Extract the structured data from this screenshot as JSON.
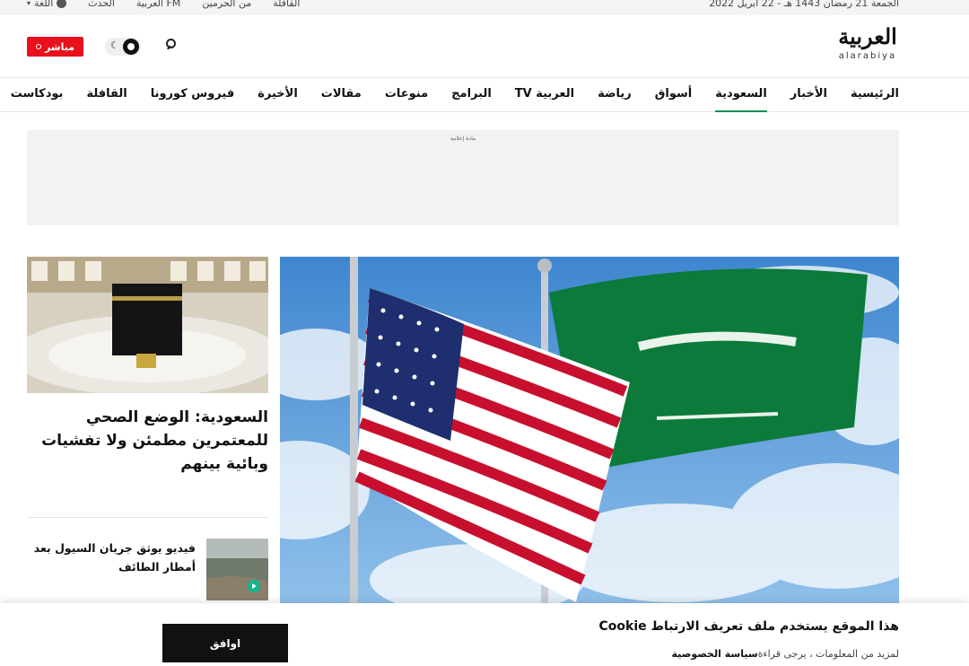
{
  "topbar": {
    "date": "الجمعة 21 رمضان 1443 هـ - 22 ابريل 2022",
    "links": [
      "القافلة",
      "من الحرمين",
      "العربية FM",
      "الحدث"
    ],
    "language_label": "اللغة"
  },
  "header": {
    "logo_ar": "العربية",
    "logo_en": "alarabiya",
    "live_label": "مباشر"
  },
  "nav": {
    "items": [
      {
        "label": "الرئيسية",
        "active": false
      },
      {
        "label": "الأخبار",
        "active": false
      },
      {
        "label": "السعودية",
        "active": true
      },
      {
        "label": "أسواق",
        "active": false
      },
      {
        "label": "رياضة",
        "active": false
      },
      {
        "label": "العربية TV",
        "active": false
      },
      {
        "label": "البرامج",
        "active": false
      },
      {
        "label": "منوعات",
        "active": false
      },
      {
        "label": "مقالات",
        "active": false
      },
      {
        "label": "الأخيرة",
        "active": false
      },
      {
        "label": "فيروس كورونا",
        "active": false
      },
      {
        "label": "القافلة",
        "active": false
      },
      {
        "label": "بودكاست",
        "active": false
      }
    ],
    "active_color": "#0a8f5a"
  },
  "ad": {
    "label": "مادة إعلانية"
  },
  "side": {
    "story_title": "السعودية: الوضع الصحي للمعتمرين مطمئن ولا تفشيات وبائية بينهم",
    "video_title": "فيديو يوثق جريان السيول بعد أمطار الطائف"
  },
  "cookie": {
    "title": "هذا الموقع يستخدم ملف تعريف الارتباط Cookie",
    "text": "لمزيد من المعلومات ، يرجى قراءة",
    "link": "سياسة الخصوصية",
    "accept_label": "اوافق"
  },
  "colors": {
    "live_red": "#e8101a",
    "button_dark": "#111111"
  },
  "icons": [
    "search-icon",
    "moon-icon",
    "sun-icon",
    "globe-icon",
    "play-icon"
  ]
}
